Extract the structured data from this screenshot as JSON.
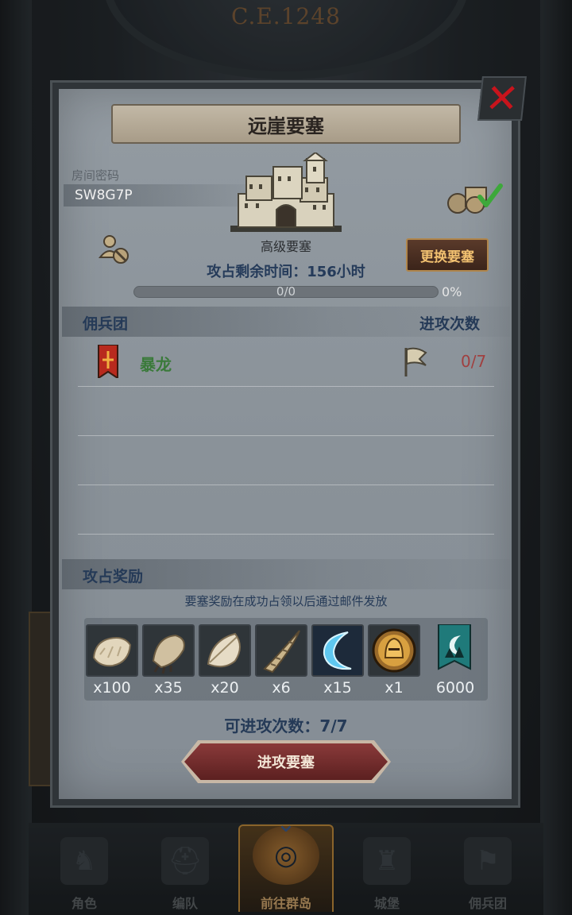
{
  "era": "C.E.1248",
  "dialog": {
    "title": "远崖要塞",
    "room_label": "房间密码",
    "room_code": "SW8G7P",
    "castle_grade": "高级要塞",
    "change_button": "更换要塞",
    "time_left": "攻占剩余时间：156小时",
    "progress_text": "0/0",
    "progress_percent": "0%",
    "progress_value": 0
  },
  "mercenary_section": {
    "title": "佣兵团",
    "right_title": "进攻次数",
    "rows": [
      {
        "name": "暴龙",
        "count": "0/7"
      }
    ]
  },
  "reward_section": {
    "title": "攻占奖励",
    "note": "要塞奖励在成功占领以后通过邮件发放",
    "rewards": [
      {
        "icon": "fur-pelt-icon",
        "qty": "x100"
      },
      {
        "icon": "claw-icon",
        "qty": "x35"
      },
      {
        "icon": "feather-icon",
        "qty": "x20"
      },
      {
        "icon": "horn-icon",
        "qty": "x6"
      },
      {
        "icon": "blue-crescent-blade-icon",
        "qty": "x15"
      },
      {
        "icon": "golden-helmet-icon",
        "qty": "x1"
      },
      {
        "icon": "mercenary-banner-icon",
        "qty": "6000"
      }
    ]
  },
  "attacks_left": "可进攻次数：7/7",
  "attack_button": "进攻要塞",
  "bottom_nav": [
    {
      "label": "角色",
      "icon": "knight-icon"
    },
    {
      "label": "编队",
      "icon": "helmet-icon"
    },
    {
      "label": "前往群岛",
      "icon": "island-icon"
    },
    {
      "label": "城堡",
      "icon": "castle-icon"
    },
    {
      "label": "佣兵团",
      "icon": "flag-icon"
    }
  ],
  "colors": {
    "accent_gold": "#c99b4a",
    "close_red": "#c8141c",
    "mercenary_green": "#3a7a3a",
    "count_red": "#a04040",
    "attack_button": "#8a3a3a"
  }
}
